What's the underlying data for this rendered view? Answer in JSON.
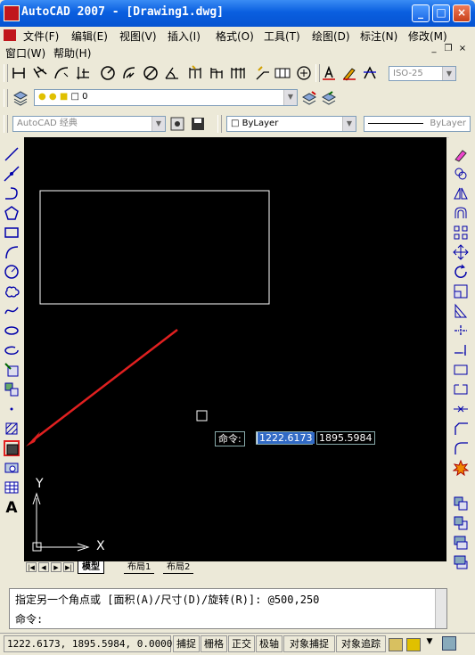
{
  "window": {
    "title": "AutoCAD 2007 - [Drawing1.dwg]",
    "minimize": "_",
    "maximize": "□",
    "close": "×"
  },
  "menu": {
    "row1": [
      "文件(F)",
      "编辑(E)",
      "视图(V)",
      "插入(I)",
      "格式(O)",
      "工具(T)",
      "绘图(D)",
      "标注(N)",
      "修改(M)"
    ],
    "row2": [
      "窗口(W)",
      "帮助(H)"
    ]
  },
  "toolbars": {
    "dimstyle_combo": "ISO-25",
    "layer_combo": "0",
    "workspace_combo": "AutoCAD 经典",
    "color_combo": "ByLayer",
    "linetype_combo": "ByLayer"
  },
  "canvas": {
    "dyn_label": "命令:",
    "dyn_x": "1222.6173",
    "dyn_y": "1895.5984",
    "ucs_y": "Y",
    "ucs_x": "X"
  },
  "layout_tabs": [
    "模型",
    "布局1",
    "布局2"
  ],
  "command": {
    "history": "指定另一个角点或 [面积(A)/尺寸(D)/旋转(R)]: @500,250",
    "prompt": "命令:"
  },
  "status": {
    "coords": "1222.6173, 1895.5984, 0.0000",
    "toggles": [
      "捕捉",
      "栅格",
      "正交",
      "极轴",
      "对象捕捉",
      "对象追踪"
    ]
  },
  "colors": {
    "highlight_box": "#e02020",
    "arrow": "#e02020",
    "titlebar": "#0a5fe0"
  }
}
